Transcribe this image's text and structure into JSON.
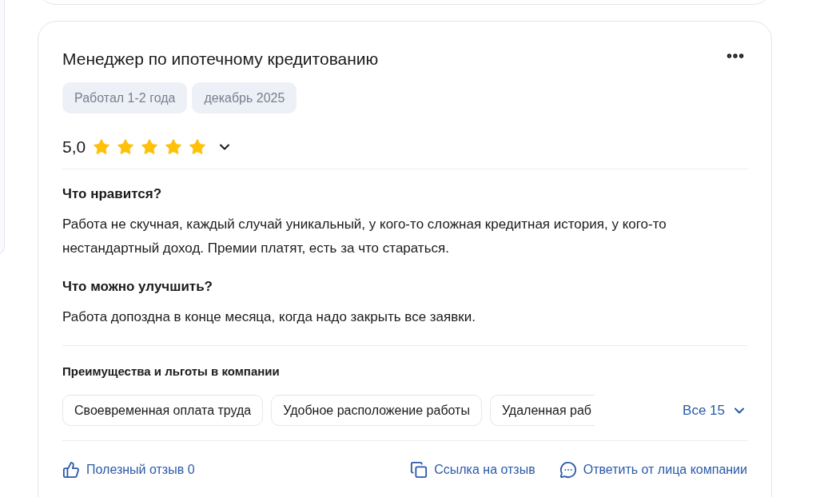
{
  "review": {
    "title": "Менеджер по ипотечному кредитованию",
    "tags": [
      "Работал 1-2 года",
      "декабрь 2025"
    ],
    "rating": "5,0",
    "stars": 5,
    "sections": [
      {
        "heading": "Что нравится?",
        "text": "Работа не скучная, каждый случай уникальный, у кого-то сложная кредитная история, у кого-то нестандартный доход. Премии платят, есть за что стараться."
      },
      {
        "heading": "Что можно улучшить?",
        "text": "Работа допоздна в конце месяца, когда надо закрыть все заявки."
      }
    ],
    "benefits": {
      "heading": "Преимущества и льготы в компании",
      "items": [
        "Своевременная оплата труда",
        "Удобное расположение работы",
        "Удаленная раб"
      ],
      "more": "Все 15"
    },
    "actions": [
      {
        "kind": "like",
        "label": "Полезный отзыв 0"
      },
      {
        "kind": "link",
        "label": "Ссылка на отзыв"
      },
      {
        "kind": "reply",
        "label": "Ответить от лица компании"
      }
    ]
  }
}
